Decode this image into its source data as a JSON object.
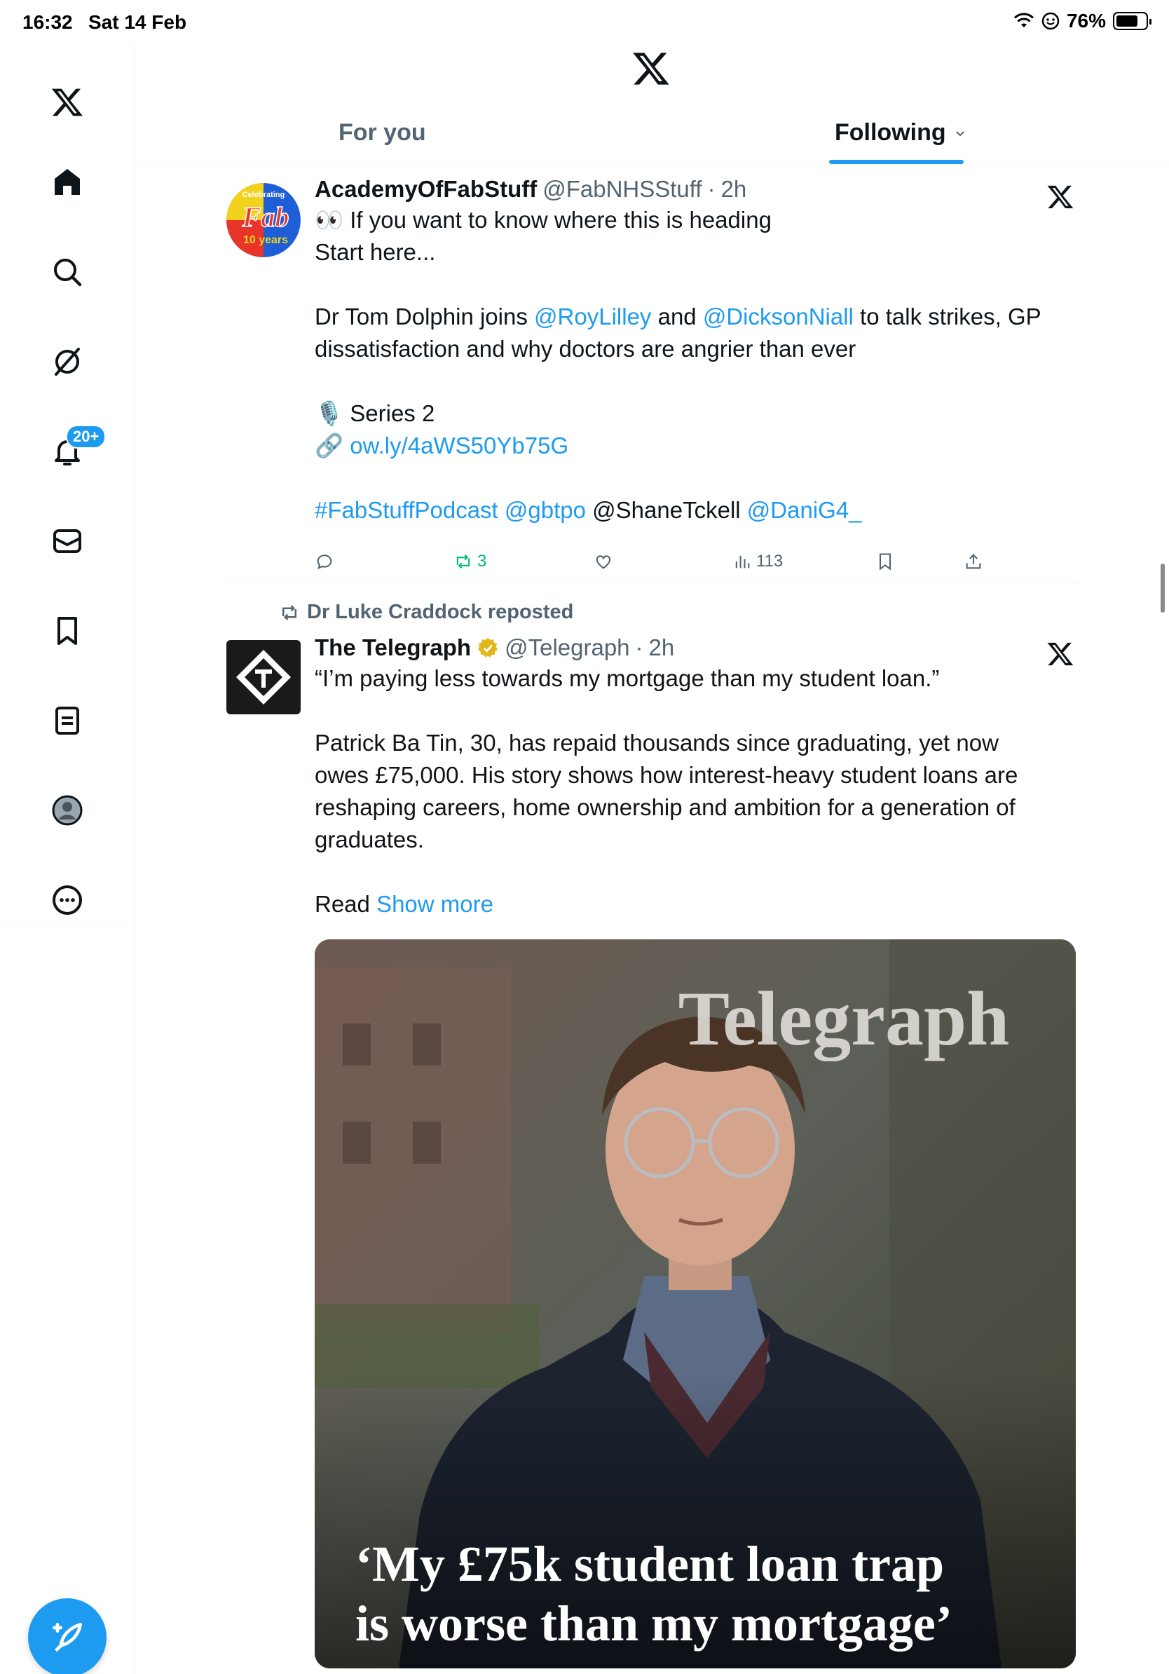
{
  "status_bar": {
    "time": "16:32",
    "date": "Sat 14 Feb",
    "battery": "76%",
    "battery_level": 0.76
  },
  "sidebar": {
    "items": [
      {
        "name": "home-icon"
      },
      {
        "name": "search-icon"
      },
      {
        "name": "grok-icon"
      },
      {
        "name": "notifications-icon",
        "badge": "20+"
      },
      {
        "name": "messages-icon"
      },
      {
        "name": "bookmarks-icon"
      },
      {
        "name": "lists-icon"
      },
      {
        "name": "profile-icon"
      },
      {
        "name": "more-icon"
      }
    ],
    "compose": {
      "name": "compose-icon"
    }
  },
  "header": {
    "tabs": [
      {
        "label": "For you",
        "active": false
      },
      {
        "label": "Following",
        "active": true
      }
    ]
  },
  "feed": {
    "tweets": [
      {
        "display_name": "AcademyOfFabStuff",
        "handle": "@FabNHSStuff",
        "dot": "·",
        "time": "2h",
        "avatar_text_top": "Celebrating",
        "avatar_text_mid": "Fab",
        "avatar_text_bottom": "10 years",
        "lines": {
          "l1": "👀 If you want to know where this is heading",
          "l2": "Start here...",
          "l4a": "Dr Tom Dolphin joins ",
          "l4b": "@RoyLilley",
          "l4c": " and ",
          "l4d": "@DicksonNiall",
          "l4e": " to talk strikes, GP",
          "l5": "dissatisfaction and why doctors are angrier than ever",
          "l7": "🎙️ Series 2",
          "l8a": "🔗 ",
          "l8b": "ow.ly/4aWS50Yb75G",
          "l10a": "#FabStuffPodcast",
          "l10b": " ",
          "l10c": "@gbtpo",
          "l10d": " @ShaneTckell ",
          "l10e": "@DaniG4_"
        },
        "stats": {
          "reposts": "3",
          "views": "113"
        }
      },
      {
        "reposted_by": "Dr Luke Craddock reposted",
        "display_name": "The Telegraph",
        "handle": "@Telegraph",
        "dot": "·",
        "time": "2h",
        "verified_color": "#e2b719",
        "lines": {
          "l1": "“I’m paying less towards my mortgage than my student loan.”",
          "l3": "Patrick Ba Tin, 30, has repaid thousands since graduating, yet now",
          "l4": "owes £75,000. His story shows how interest-heavy student loans are",
          "l5": "reshaping careers, home ownership and ambition for a generation of",
          "l6": "graduates.",
          "l8a": "Read ",
          "l8b": "Show more"
        },
        "media": {
          "masthead": "Telegraph",
          "headline_1": "‘My £75k student loan trap",
          "headline_2": "is worse than my mortgage’"
        }
      }
    ]
  },
  "colors": {
    "accent": "#1d9bf0",
    "repost": "#00ba7c",
    "muted": "#536471"
  }
}
